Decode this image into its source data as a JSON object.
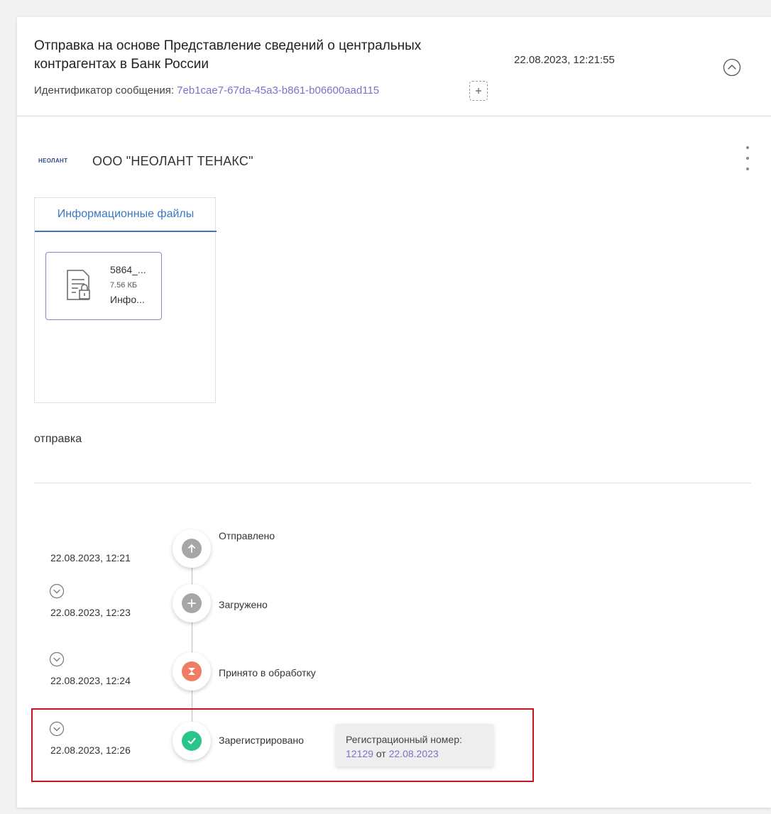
{
  "header": {
    "title": "Отправка на основе Представление сведений о центральных контрагентах в Банк России",
    "id_label": "Идентификатор сообщения:",
    "id_value": "7eb1cae7-67da-45a3-b861-b06600aad115",
    "date": "22.08.2023, 12:21:55",
    "icons": {
      "copy": "copy-icon",
      "collapse": "chevron-up-circle-icon"
    }
  },
  "org": {
    "logo_text": "НЕОЛАНТ",
    "name": "ООО \"НЕОЛАНТ ТЕНАКС\"",
    "menu_icon": "more-vertical-icon"
  },
  "files": {
    "tab_label": "Информационные файлы",
    "items": [
      {
        "name": "5864_...",
        "size": "7.56 КБ",
        "type": "Инфо...",
        "icon": "locked-document-icon"
      }
    ]
  },
  "comment": "отправка",
  "timeline": [
    {
      "date": "22.08.2023, 12:21",
      "status": "Отправлено",
      "icon": "arrow-up-icon",
      "color": "#a6a6a6",
      "expandable": false
    },
    {
      "date": "22.08.2023, 12:23",
      "status": "Загружено",
      "icon": "plus-icon",
      "color": "#a6a6a6",
      "expandable": true
    },
    {
      "date": "22.08.2023, 12:24",
      "status": "Принято в обработку",
      "icon": "hourglass-icon",
      "color": "#ee7d63",
      "expandable": true
    },
    {
      "date": "22.08.2023, 12:26",
      "status": "Зарегистрировано",
      "icon": "check-icon",
      "color": "#2bc48a",
      "expandable": true
    }
  ],
  "registration": {
    "label": "Регистрационный номер:",
    "number": "12129",
    "from": "от",
    "date": "22.08.2023"
  },
  "colors": {
    "accent": "#3a78c3",
    "link": "#7a73c7",
    "highlight": "#c8151b"
  }
}
